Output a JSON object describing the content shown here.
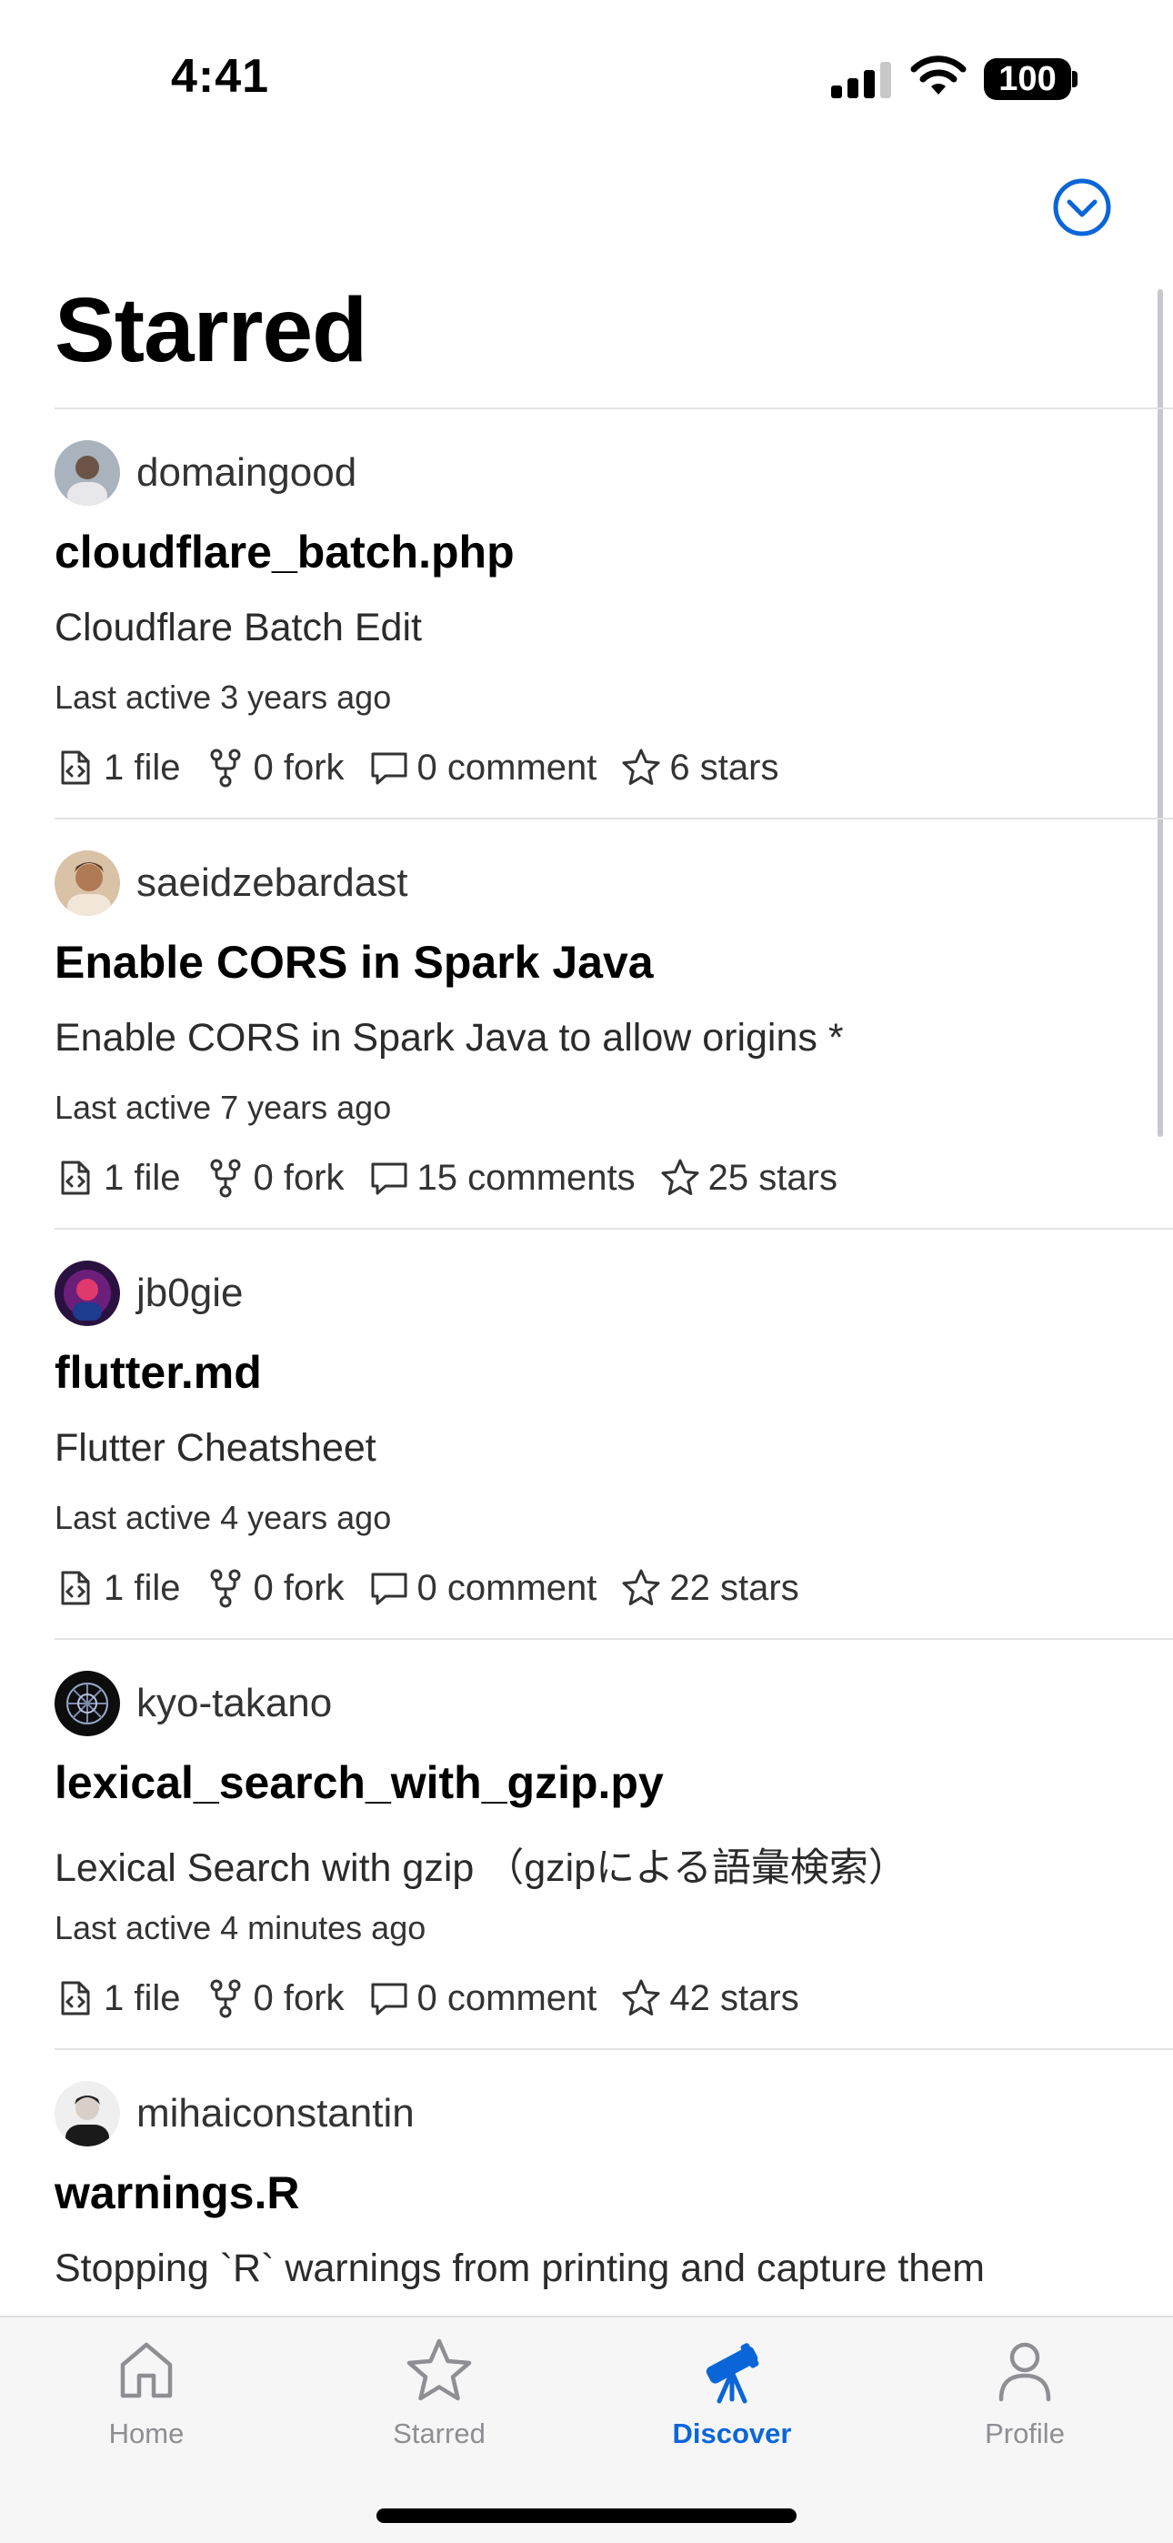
{
  "status_bar": {
    "time": "4:41",
    "battery": "100",
    "icons": [
      "signal-icon",
      "wifi-icon",
      "battery-icon"
    ]
  },
  "header": {
    "title": "Starred",
    "menu_icon": "chevron-down-circle-icon"
  },
  "gists": [
    {
      "owner": "domaingood",
      "title": "cloudflare_batch.php",
      "description": "Cloudflare Batch Edit",
      "last_active": "Last active 3 years ago",
      "files": "1 file",
      "forks": "0 fork",
      "comments": "0 comment",
      "stars": "6 stars"
    },
    {
      "owner": "saeidzebardast",
      "title": "Enable CORS in Spark Java",
      "description": "Enable CORS in Spark Java to allow origins *",
      "last_active": "Last active 7 years ago",
      "files": "1 file",
      "forks": "0 fork",
      "comments": "15 comments",
      "stars": "25 stars"
    },
    {
      "owner": "jb0gie",
      "title": "flutter.md",
      "description": "Flutter Cheatsheet",
      "last_active": "Last active 4 years ago",
      "files": "1 file",
      "forks": "0 fork",
      "comments": "0 comment",
      "stars": "22 stars"
    },
    {
      "owner": "kyo-takano",
      "title": "lexical_search_with_gzip.py",
      "description": "Lexical Search with gzip （gzipによる語彙検索）",
      "last_active": "Last active 4 minutes ago",
      "files": "1 file",
      "forks": "0 fork",
      "comments": "0 comment",
      "stars": "42 stars"
    },
    {
      "owner": "mihaiconstantin",
      "title": "warnings.R",
      "description": "Stopping `R` warnings from printing and capture them",
      "last_active": "",
      "files": "",
      "forks": "",
      "comments": "",
      "stars": ""
    }
  ],
  "tab_bar": {
    "tabs": [
      {
        "label": "Home",
        "icon": "home-icon"
      },
      {
        "label": "Starred",
        "icon": "star-icon"
      },
      {
        "label": "Discover",
        "icon": "telescope-icon"
      },
      {
        "label": "Profile",
        "icon": "person-icon"
      }
    ],
    "active_tab": "Discover"
  },
  "colors": {
    "accent": "#0a66d8",
    "inactive_tab": "#8e8e93",
    "divider": "#e3e3e6"
  }
}
